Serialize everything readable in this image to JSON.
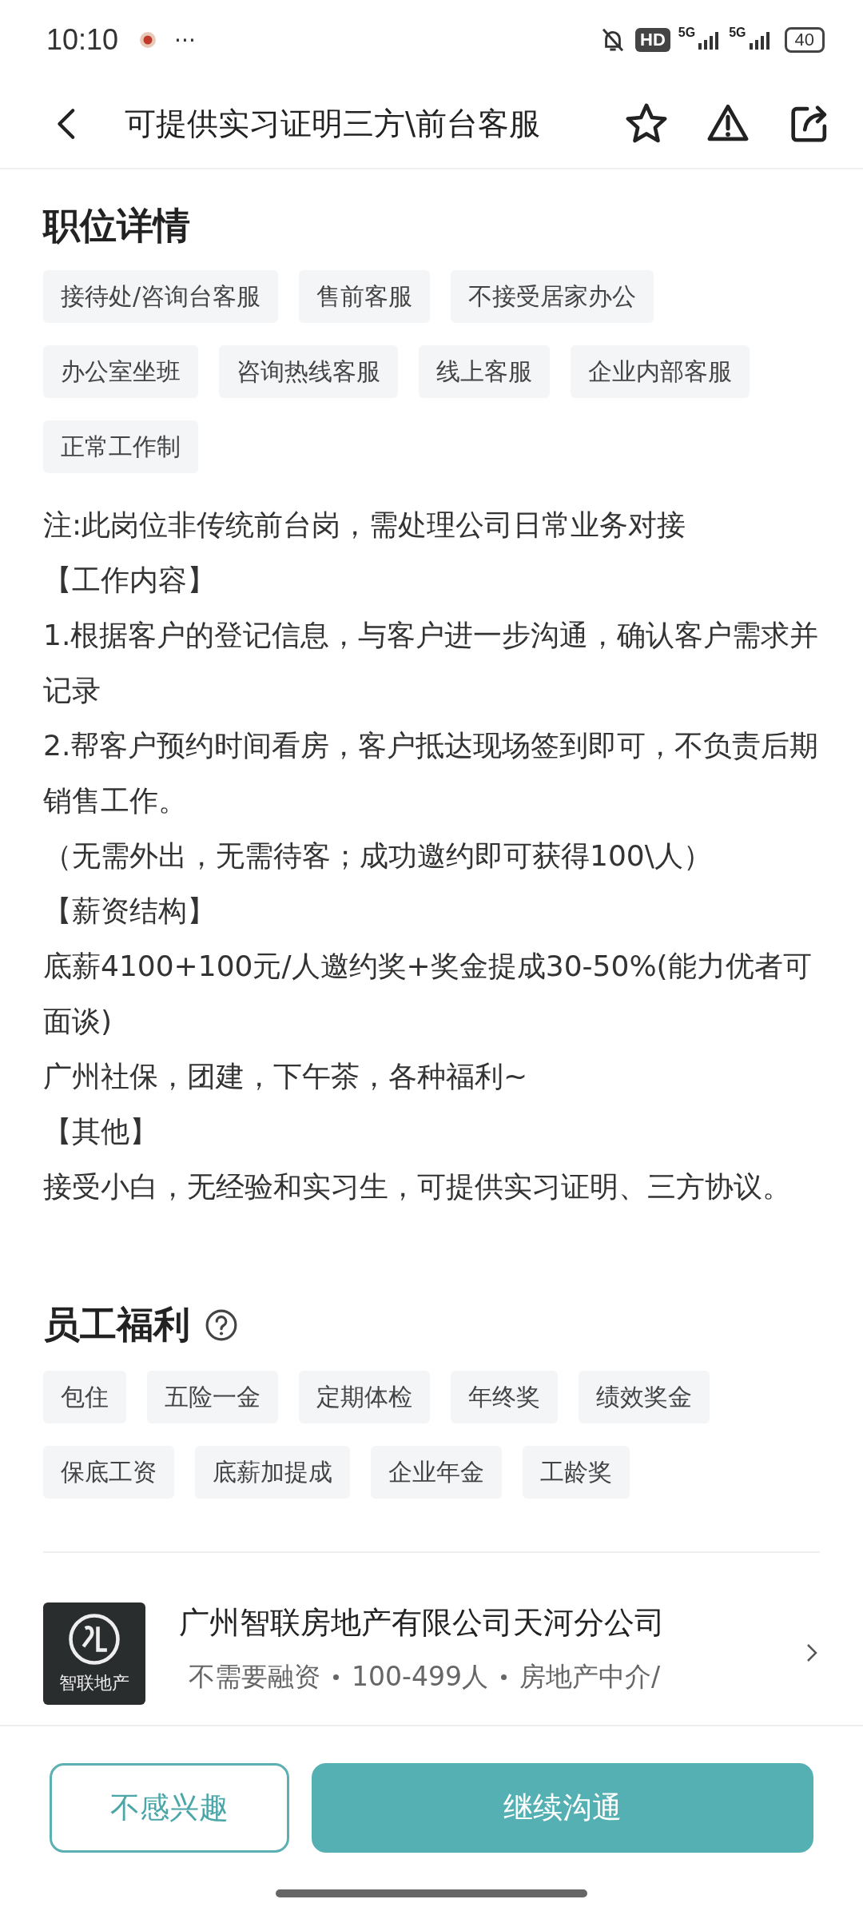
{
  "status_bar": {
    "time": "10:10",
    "dots": "···",
    "hd": "HD",
    "network_1": "5G",
    "network_2": "5G",
    "battery": "40"
  },
  "header": {
    "title": "可提供实习证明三方\\前台客服"
  },
  "job_details": {
    "title": "职位详情",
    "tags": [
      "接待处/咨询台客服",
      "售前客服",
      "不接受居家办公",
      "办公室坐班",
      "咨询热线客服",
      "线上客服",
      "企业内部客服",
      "正常工作制"
    ],
    "paragraphs": [
      "注:此岗位非传统前台岗，需处理公司日常业务对接",
      "【工作内容】",
      "1.根据客户的登记信息，与客户进一步沟通，确认客户需求并记录",
      "2.帮客户预约时间看房，客户抵达现场签到即可，不负责后期销售工作。",
      "（无需外出，无需待客；成功邀约即可获得100\\人）",
      "【薪资结构】",
      "底薪4100+100元/人邀约奖+奖金提成30-50%(能力优者可面谈)",
      "广州社保，团建，下午茶，各种福利~",
      "【其他】",
      "接受小白，无经验和实习生，可提供实习证明、三方协议。"
    ]
  },
  "benefits": {
    "title": "员工福利",
    "tags": [
      "包住",
      "五险一金",
      "定期体检",
      "年终奖",
      "绩效奖金",
      "保底工资",
      "底薪加提成",
      "企业年金",
      "工龄奖"
    ]
  },
  "company": {
    "logo_text": "智联地产",
    "name": "广州智联房地产有限公司天河分公司",
    "meta": [
      "不需要融资",
      "100-499人",
      "房地产中介/"
    ]
  },
  "actions": {
    "secondary": "不感兴趣",
    "primary": "继续沟通"
  }
}
